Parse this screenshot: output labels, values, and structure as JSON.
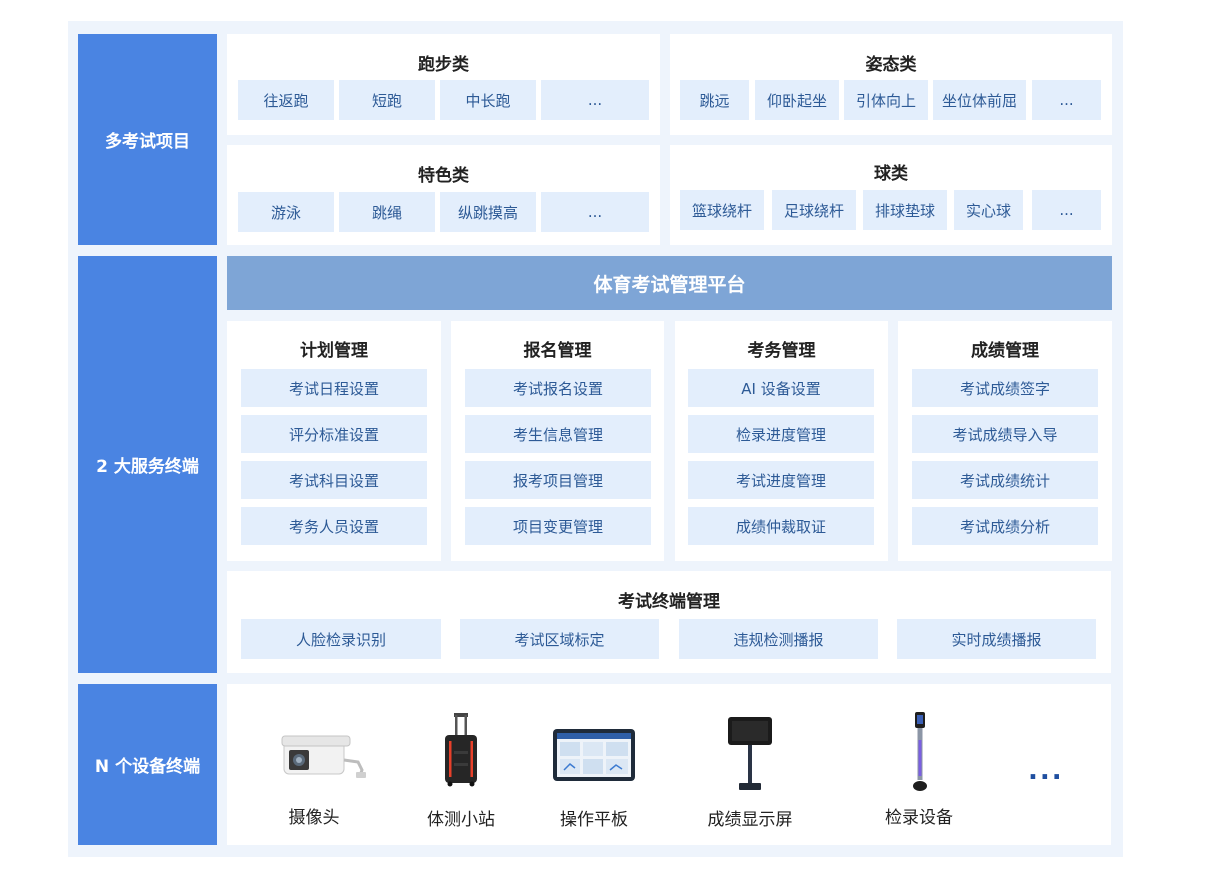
{
  "rows": {
    "exam_items": "多考试项目",
    "service_terminals": "2 大服务终端",
    "device_terminals": "N 个设备终端"
  },
  "categories": {
    "running": {
      "title": "跑步类",
      "items": [
        "往返跑",
        "短跑",
        "中长跑",
        "..."
      ]
    },
    "posture": {
      "title": "姿态类",
      "items": [
        "跳远",
        "仰卧起坐",
        "引体向上",
        "坐位体前屈",
        "..."
      ]
    },
    "special": {
      "title": "特色类",
      "items": [
        "游泳",
        "跳绳",
        "纵跳摸高",
        "..."
      ]
    },
    "ball": {
      "title": "球类",
      "items": [
        "篮球绕杆",
        "足球绕杆",
        "排球垫球",
        "实心球",
        "..."
      ]
    }
  },
  "platform": {
    "title": "体育考试管理平台"
  },
  "modules": [
    {
      "title": "计划管理",
      "items": [
        "考试日程设置",
        "评分标准设置",
        "考试科目设置",
        "考务人员设置"
      ]
    },
    {
      "title": "报名管理",
      "items": [
        "考试报名设置",
        "考生信息管理",
        "报考项目管理",
        "项目变更管理"
      ]
    },
    {
      "title": "考务管理",
      "items": [
        "AI 设备设置",
        "检录进度管理",
        "考试进度管理",
        "成绩仲裁取证"
      ]
    },
    {
      "title": "成绩管理",
      "items": [
        "考试成绩签字",
        "考试成绩导入导",
        "考试成绩统计",
        "考试成绩分析"
      ]
    }
  ],
  "terminal": {
    "title": "考试终端管理",
    "items": [
      "人脸检录识别",
      "考试区域标定",
      "违规检测播报",
      "实时成绩播报"
    ]
  },
  "devices": [
    {
      "name": "摄像头",
      "icon": "camera-icon"
    },
    {
      "name": "体测小站",
      "icon": "suitcase-station-icon"
    },
    {
      "name": "操作平板",
      "icon": "tablet-icon"
    },
    {
      "name": "成绩显示屏",
      "icon": "display-stand-icon"
    },
    {
      "name": "检录设备",
      "icon": "checkin-pole-icon"
    }
  ],
  "devices_more": "...",
  "colors": {
    "side": "#4a84e2",
    "banner": "#7ea5d6",
    "chip_bg": "#e3eefc",
    "chip_text": "#2d5a96",
    "frame": "#eef4fc"
  }
}
